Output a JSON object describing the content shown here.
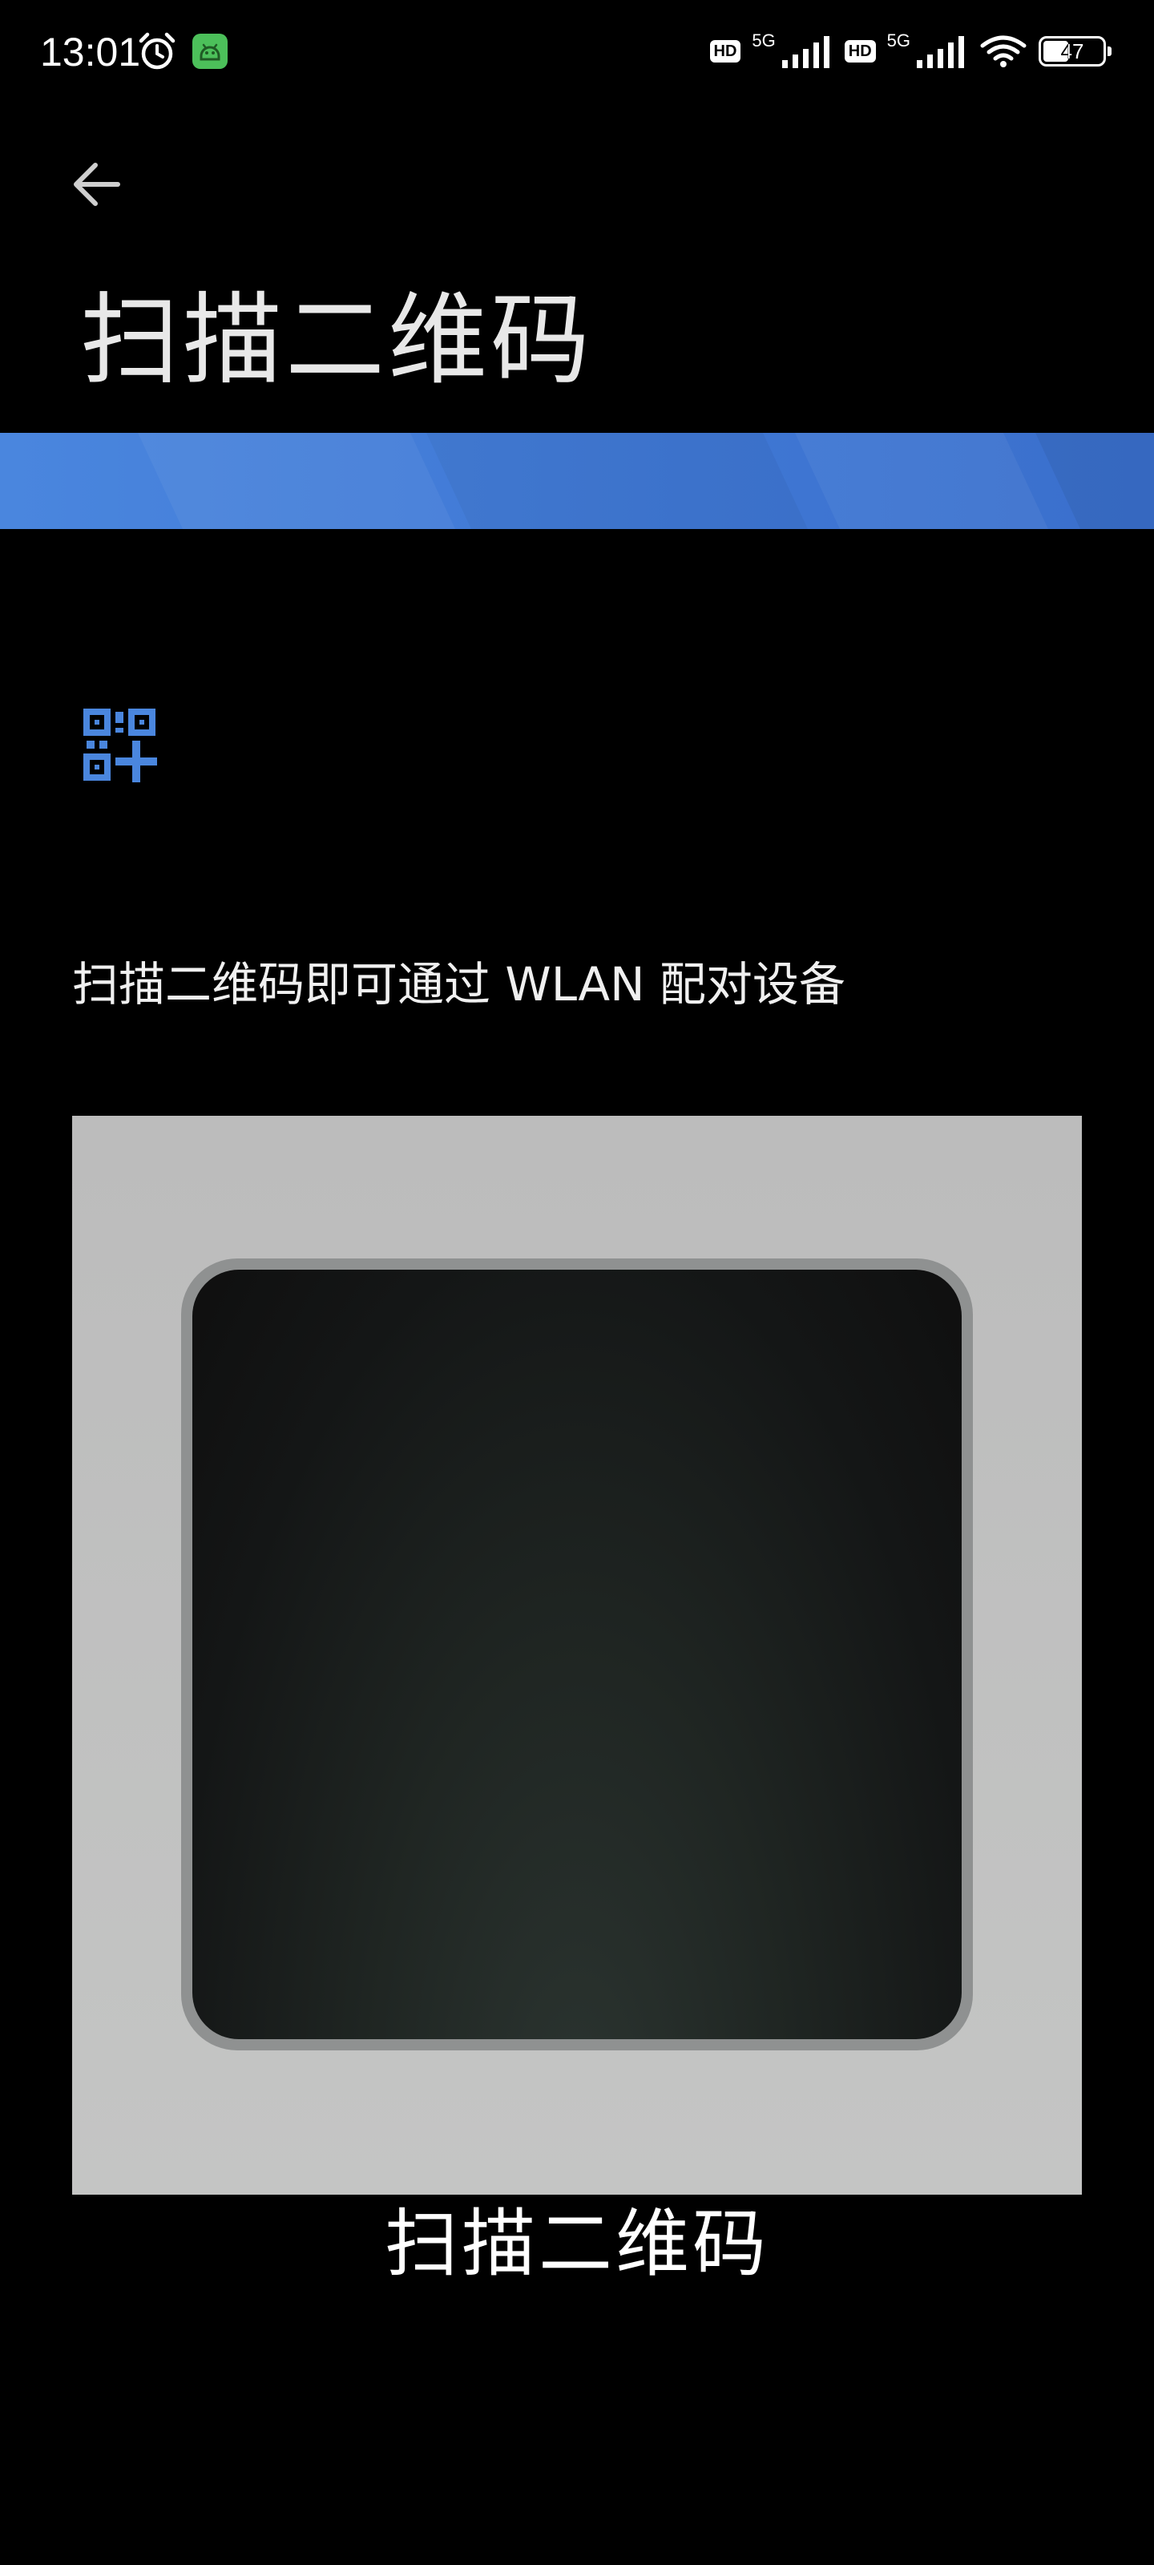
{
  "status_bar": {
    "time": "13:01",
    "alarm_icon": "alarm-clock-icon",
    "app_badge_icon": "android-app-icon",
    "sim1": {
      "hd": "HD",
      "network": "5G"
    },
    "sim2": {
      "hd": "HD",
      "network": "5G"
    },
    "wifi_icon": "wifi-icon",
    "battery_level": "47",
    "battery_fraction": 0.47
  },
  "toolbar": {
    "back_icon": "arrow-left-icon",
    "title": "扫描二维码"
  },
  "colors": {
    "banner_blue": "#4a86de",
    "qr_icon_blue": "#4a86de",
    "scanner_frame": "#c0c0c0",
    "background": "#000000"
  },
  "content": {
    "qr_icon": "qr-code-add-icon",
    "instruction": "扫描二维码即可通过 WLAN 配对设备",
    "scan_caption": "扫描二维码"
  }
}
